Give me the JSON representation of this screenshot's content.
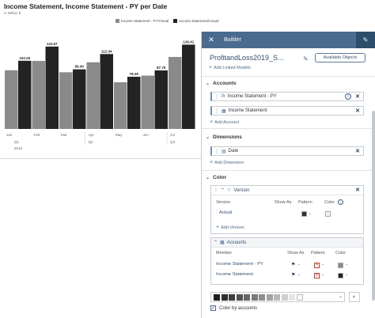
{
  "chart": {
    "title": "Income Statement, Income Statement - PY per Date",
    "subtitle": "in Million $",
    "legend": [
      {
        "name": "Income Statement - PY/Actual",
        "color": "#8a8a8a"
      },
      {
        "name": "Income Statement/Actual",
        "color": "#232323"
      }
    ],
    "quarter_labels": [
      "Q1",
      "Q2",
      "Q3"
    ],
    "year_label": "2019"
  },
  "chart_data": {
    "type": "bar",
    "title": "Income Statement, Income Statement - PY per Date",
    "categories": [
      "Jan",
      "Feb",
      "Mar",
      "Apr",
      "May",
      "Jun",
      "Jul"
    ],
    "series": [
      {
        "name": "Income Statement - PY/Actual",
        "color": "#8a8a8a",
        "values": [
          88,
          102,
          85,
          100,
          70,
          80,
          108
        ]
      },
      {
        "name": "Income Statement/Actual",
        "color": "#232323",
        "values": [
          102.26,
          123.57,
          89.4,
          112.34,
          78.29,
          87.76,
          126.41
        ]
      }
    ],
    "data_labels": [
      "102.26",
      "123.57",
      "89.40",
      "112.34",
      "78.29",
      "87.76",
      "126.41"
    ],
    "ylim": [
      0,
      140
    ],
    "grid": false,
    "legend_position": "top-right"
  },
  "builder": {
    "header_title": "Builder",
    "model_name": "ProfitandLoss2019_S...",
    "available_objects": "Available Objects",
    "add_linked_models": "Add Linked Models",
    "accounts": {
      "title": "Accounts",
      "items": [
        {
          "label": "Income Statement - PY",
          "icon": "fx-icon",
          "has_info": true
        },
        {
          "label": "Income Statement",
          "icon": "table-icon",
          "has_info": false
        }
      ],
      "add_label": "Add Account"
    },
    "dimensions": {
      "title": "Dimensions",
      "items": [
        {
          "label": "Date",
          "icon": "calendar-icon"
        }
      ],
      "add_label": "Add Dimension"
    },
    "color": {
      "title": "Color",
      "version_box": {
        "title": "Version",
        "col_version": "Version",
        "col_show_as": "Show As",
        "col_pattern": "Pattern",
        "col_color": "Color",
        "rows": [
          {
            "label": "Actual",
            "pattern_color": "#333333",
            "color": "#f2f2f2"
          }
        ],
        "add_label": "Add Version"
      },
      "accounts_box": {
        "title": "Accounts",
        "col_member": "Member",
        "col_show_as": "Show As",
        "col_pattern": "Pattern",
        "col_color": "Color",
        "rows": [
          {
            "label": "Income Statement - PY",
            "color": "#8a8a8a"
          },
          {
            "label": "Income Statement",
            "color": "#232323"
          }
        ]
      },
      "palette": [
        "#1e1e1e",
        "#2e2e2e",
        "#3e3e3e",
        "#525252",
        "#666666",
        "#7a7a7a",
        "#8e8e8e",
        "#a2a2a2",
        "#b8b8b8",
        "#cfcfcf",
        "#e4e4e4",
        "#f7f7f7"
      ],
      "color_by_accounts": "Color by accounts"
    }
  }
}
